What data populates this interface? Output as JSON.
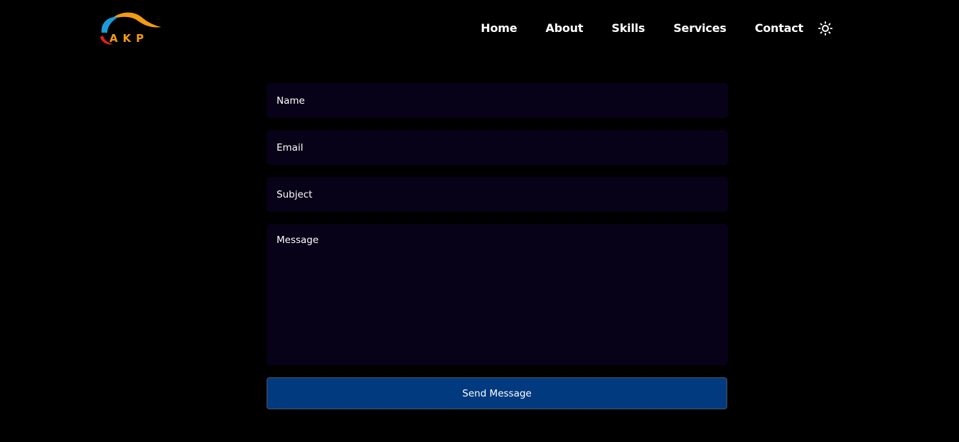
{
  "header": {
    "logo_text": "AKP",
    "nav": [
      {
        "label": "Home"
      },
      {
        "label": "About"
      },
      {
        "label": "Skills"
      },
      {
        "label": "Services"
      },
      {
        "label": "Contact"
      }
    ],
    "theme_icon": "sun-icon"
  },
  "form": {
    "name_placeholder": "Name",
    "email_placeholder": "Email",
    "subject_placeholder": "Subject",
    "message_placeholder": "Message",
    "submit_label": "Send Message"
  },
  "colors": {
    "background": "#000000",
    "field_bg": "#070217",
    "button_bg": "#023a80",
    "logo_blue": "#1b9bd8",
    "logo_orange": "#f39c12",
    "logo_red": "#e0201b"
  }
}
